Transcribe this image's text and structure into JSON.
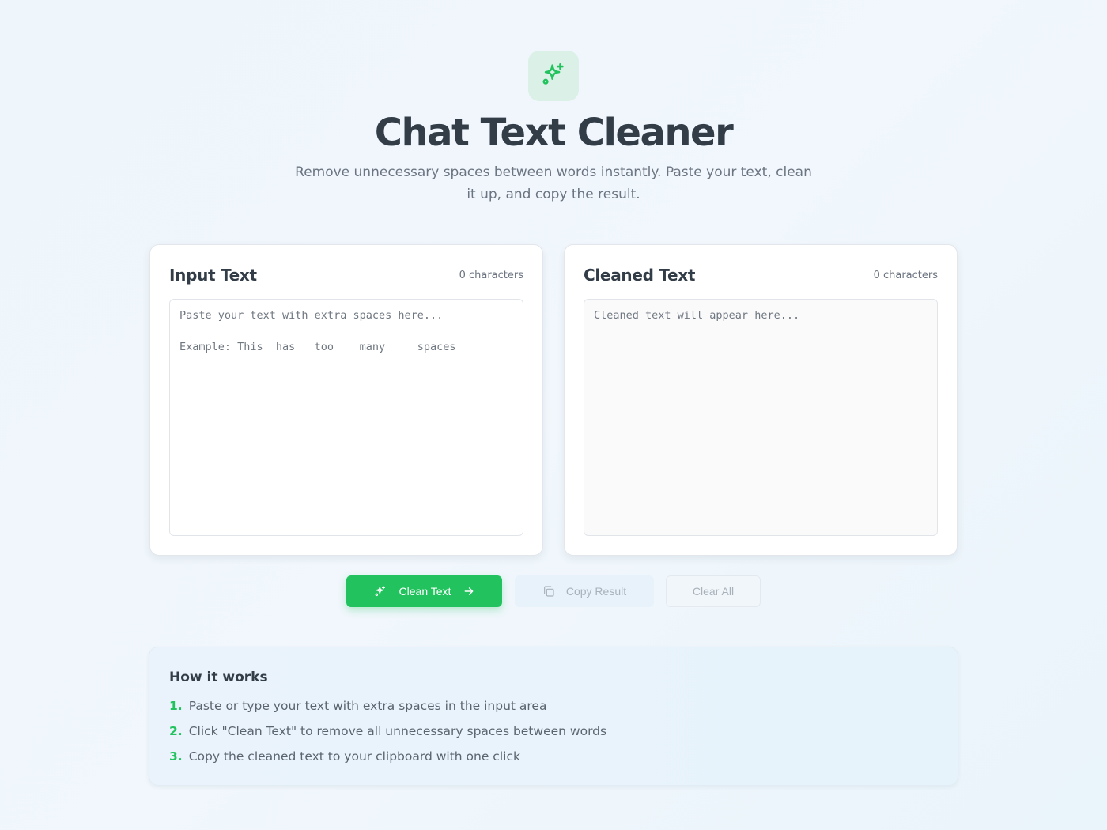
{
  "header": {
    "title": "Chat Text Cleaner",
    "subtitle": "Remove unnecessary spaces between words instantly. Paste your text, clean it up, and copy the result.",
    "logo_icon": "sparkles-icon"
  },
  "input_panel": {
    "title": "Input Text",
    "count": "0 characters",
    "value": "",
    "placeholder": "Paste your text with extra spaces here...\n\nExample: This  has   too    many     spaces"
  },
  "output_panel": {
    "title": "Cleaned Text",
    "count": "0 characters",
    "value": "",
    "placeholder": "Cleaned text will appear here..."
  },
  "actions": {
    "clean_label": "Clean Text",
    "copy_label": "Copy Result",
    "clear_label": "Clear All"
  },
  "how_it_works": {
    "title": "How it works",
    "steps": [
      {
        "num": "1.",
        "text": "Paste or type your text with extra spaces in the input area"
      },
      {
        "num": "2.",
        "text": "Click \"Clean Text\" to remove all unnecessary spaces between words"
      },
      {
        "num": "3.",
        "text": "Copy the cleaned text to your clipboard with one click"
      }
    ]
  },
  "colors": {
    "accent": "#22c35e",
    "background": "#eef5fb",
    "text": "#333d48"
  }
}
